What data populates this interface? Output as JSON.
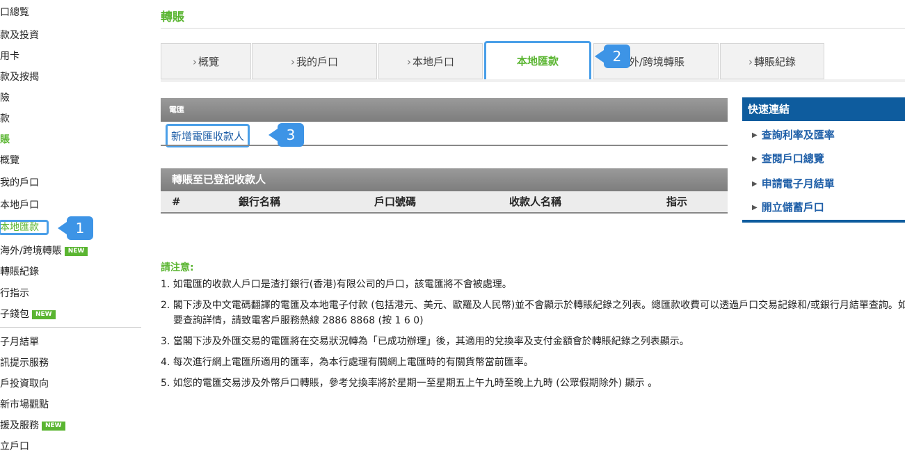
{
  "sidebar": {
    "items": [
      {
        "label": "口總覧"
      },
      {
        "label": "款及投資"
      },
      {
        "label": "用卡"
      },
      {
        "label": "款及按揭"
      },
      {
        "label": "險"
      },
      {
        "label": "款"
      },
      {
        "label": "賬"
      },
      {
        "label": "概覽"
      },
      {
        "label": "我的戶口"
      },
      {
        "label": "本地戶口"
      },
      {
        "label": "本地匯款"
      },
      {
        "label": "海外/跨境轉賬"
      },
      {
        "label": "轉賬紀錄"
      },
      {
        "label": "行指示"
      },
      {
        "label": "子錢包"
      },
      {
        "label": "子月結單"
      },
      {
        "label": "訊提示服務"
      },
      {
        "label": "戶投資取向"
      },
      {
        "label": "新市場觀點"
      },
      {
        "label": "援及服務"
      },
      {
        "label": "立戶口"
      }
    ],
    "new_badge": "NEW"
  },
  "callouts": [
    "1",
    "2",
    "3"
  ],
  "page": {
    "title": "轉賬"
  },
  "tabs": [
    {
      "label": "概覽",
      "chevron": "›"
    },
    {
      "label": "我的戶口",
      "chevron": "›"
    },
    {
      "label": "本地戶口",
      "chevron": "›"
    },
    {
      "label": "本地匯款",
      "chevron": ""
    },
    {
      "label": "外/跨境轉賬",
      "chevron": ""
    },
    {
      "label": "轉賬紀錄",
      "chevron": "›"
    }
  ],
  "wire": {
    "header": "電匯",
    "add_payee_link": "新增電匯收款人"
  },
  "registered": {
    "header": "轉賬至已登記收款人",
    "columns": [
      "#",
      "銀行名稱",
      "戶口號碼",
      "收款人名稱",
      "指示"
    ]
  },
  "quick_links": {
    "title": "快速連結",
    "items": [
      "查詢利率及匯率",
      "查閱戶口總覽",
      "申請電子月結單",
      "開立儲蓄戶口"
    ]
  },
  "notice": {
    "title": "請注意:",
    "items": [
      "1. 如電匯的收款人戶口是渣打銀行(香港)有限公司的戶口，該電匯將不會被處理。",
      "2. 閣下涉及中文電碼翻譯的電匯及本地電子付款 (包括港元、美元、歐羅及人民幣)並不會顯示於轉賬紀錄之列表。總匯款收費可以透過戶口交易記錄和/或銀行月結單查詢。如要查詢詳情，請致電客戶服務熱線 2886 8868 (按 1 6 0)",
      "3. 當閣下涉及外匯交易的電匯將在交易狀況轉為「已成功辦理」後，其適用的兌換率及支付金額會於轉賬紀錄之列表顯示。",
      "4. 每次進行網上電匯所適用的匯率，為本行處理有關網上電匯時的有關貨幣當前匯率。",
      "5. 如您的電匯交易涉及外幣戶口轉賬，參考兌換率將於星期一至星期五上午九時至晚上九時 (公眾假期除外) 顯示 。"
    ]
  }
}
